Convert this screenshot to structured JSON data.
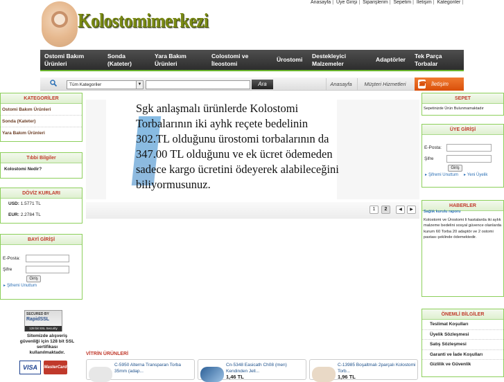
{
  "top_links": [
    "Anasayfa",
    "Üye Girişi",
    "Siparişlerim",
    "Sepetim",
    "İletişim",
    "Kategoriler"
  ],
  "logo_text": "Kolostomimerkezi",
  "nav": [
    {
      "label": "Ostomi Bakım Ürünleri"
    },
    {
      "label": "Sonda (Kateter)"
    },
    {
      "label": "Yara Bakım Ürünleri"
    },
    {
      "label": "Colostomi ve İleostomi"
    },
    {
      "label": "Ürostomi"
    },
    {
      "label": "Destekleyici Malzemeler"
    },
    {
      "label": "Adaptörler"
    },
    {
      "label": "Tek Parça Torbalar"
    }
  ],
  "search": {
    "category": "Tüm Kategoriler",
    "button": "Ara",
    "value": ""
  },
  "quick": {
    "home": "Anasayfa",
    "service": "Müşteri Hizmetleri",
    "contact": "İletişim"
  },
  "categories": {
    "title": "KATEGORİLER",
    "items": [
      "Ostomi Bakım Ürünleri",
      "Sonda (Kateter)",
      "Yara Bakım Ürünleri"
    ]
  },
  "medical": {
    "title": "Tıbbi Bilgiler",
    "items": [
      "Kolostomi Nedir?"
    ]
  },
  "fx": {
    "title": "DÖVİZ KURLARI",
    "usd_label": "USD:",
    "usd_value": "1.5771 TL",
    "eur_label": "EUR:",
    "eur_value": "2.2784 TL"
  },
  "dealer": {
    "title": "BAYİ GİRİŞİ",
    "email_label": "E-Posta:",
    "password_label": "Şifre",
    "login": "Giriş",
    "forgot": "Şifremi Unuttum"
  },
  "ssl": {
    "line1": "SECURED BY",
    "line2": "RapidSSL",
    "line3": "128 bit SSL Security",
    "text": "Sitemizde alışveriş güvenliği için 128 bit SSL sertifikası kullanılmaktadır."
  },
  "cards": {
    "visa": "VISA",
    "mastercard": "MasterCard"
  },
  "banner": {
    "text": "Sgk anlaşmalı ürünlerde Kolostomi Torbalarının iki ayhk reçete bedelinin 302.TL olduğunu ürostomi torbalarının da 347.00 TL olduğunu ve ek ücret ödemeden sadece kargo ücretini ödeyerek alabileceğini biliyormusunuz."
  },
  "pager": {
    "pages": [
      "1",
      "2"
    ],
    "prev": "◀",
    "next": "▶"
  },
  "vitrin": {
    "title": "VİTRİN ÜRÜNLERİ",
    "products": [
      {
        "name": "C-5950 Alterna Transparan Torba 35mm (adap...",
        "price": ""
      },
      {
        "name": "Cn-5348 Easicath Ch08 (men) Kendinden Jell...",
        "price": "1,46 TL"
      },
      {
        "name": "C-13985 Boşaltmalı 2parçalı Kolostomi Torb...",
        "price": "1,96 TL"
      }
    ]
  },
  "cart": {
    "title": "SEPET",
    "text": "Sepetinizde Ürün Bulunmamaktadır"
  },
  "member": {
    "title": "ÜYE GİRİŞİ",
    "email_label": "E-Posta:",
    "password_label": "Şifre",
    "login": "Giriş",
    "forgot": "Şifremi Unuttum",
    "register": "Yeni Üyelik"
  },
  "news": {
    "title": "HABERLER",
    "headline": "Sağlık kurulu raporu",
    "body": "Kolostomi ve Ürostomi li hastalarda iki aylık malzeme bedelini sosyal güvence olanlarda kurum 60 Torba 20 adaptör ve 2 ostomi pastası şeklinde ödemektedir."
  },
  "important": {
    "title": "ÖNEMLİ BİLGİLER",
    "items": [
      "Teslimat Koşulları",
      "Üyelik Sözleşmesi",
      "Satış Sözleşmesi",
      "Garanti ve İade Koşulları",
      "Gizlilik ve Güvenlik"
    ]
  }
}
